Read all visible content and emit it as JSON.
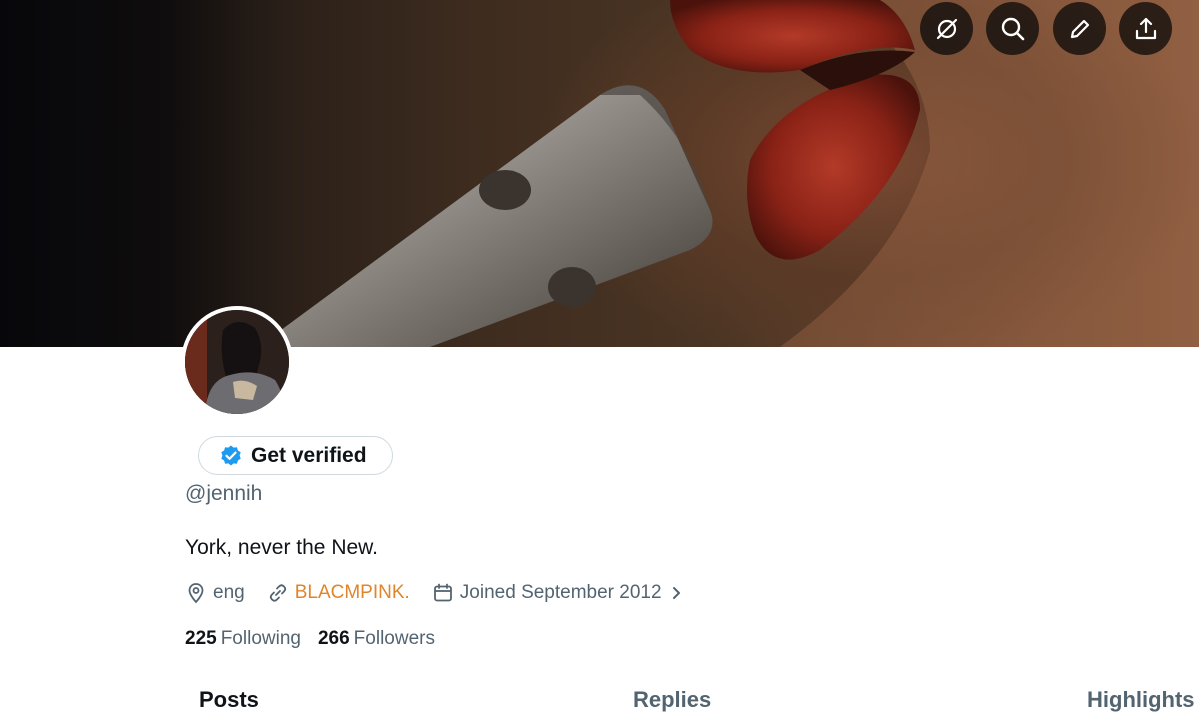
{
  "profile": {
    "verify_label": "Get verified",
    "handle": "@jennih",
    "bio": "York, never the New.",
    "location": "eng",
    "website": "BLACMPINK.",
    "joined": "Joined September 2012"
  },
  "stats": {
    "following_count": "225",
    "following_label": "Following",
    "followers_count": "266",
    "followers_label": "Followers"
  },
  "tabs": [
    {
      "label": "Posts",
      "active": true
    },
    {
      "label": "Replies",
      "active": false
    },
    {
      "label": "Highlights",
      "active": false
    }
  ],
  "icons": {
    "top_buttons": [
      "grok-icon",
      "search-icon",
      "edit-icon",
      "share-icon"
    ],
    "meta": [
      "location-pin-icon",
      "link-icon",
      "calendar-icon",
      "chevron-right-icon"
    ],
    "verify": "verified-badge-icon"
  },
  "colors": {
    "link": "#e0852a",
    "verified_badge": "#1d9bf0",
    "secondary_text": "#536471"
  }
}
